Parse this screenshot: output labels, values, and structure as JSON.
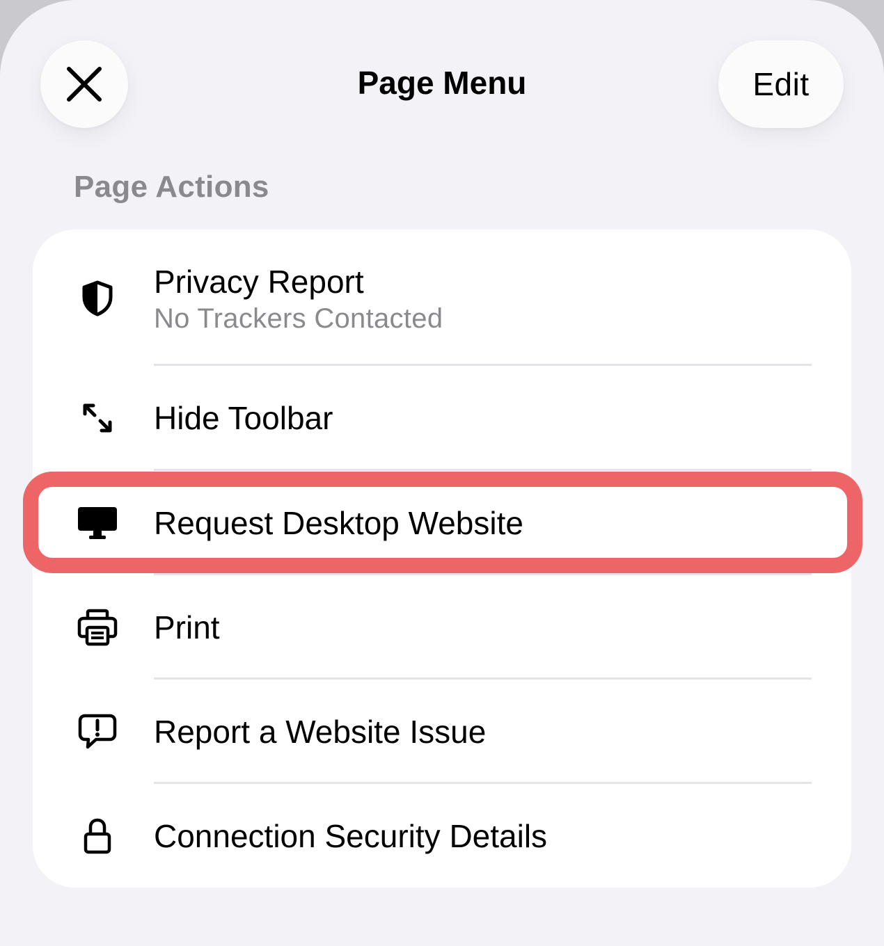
{
  "header": {
    "title": "Page Menu",
    "edit_label": "Edit"
  },
  "section": {
    "title": "Page Actions"
  },
  "items": [
    {
      "label": "Privacy Report",
      "sublabel": "No Trackers Contacted",
      "icon": "shield-icon"
    },
    {
      "label": "Hide Toolbar",
      "icon": "expand-arrows-icon"
    },
    {
      "label": "Request Desktop Website",
      "icon": "desktop-icon",
      "highlighted": true
    },
    {
      "label": "Print",
      "icon": "printer-icon"
    },
    {
      "label": "Report a Website Issue",
      "icon": "speech-bubble-exclamation-icon"
    },
    {
      "label": "Connection Security Details",
      "icon": "lock-icon"
    }
  ],
  "colors": {
    "highlight": "#ee6567",
    "sheet_background": "#f2f2f7",
    "card_background": "#ffffff",
    "secondary_text": "#8a8a8e"
  }
}
